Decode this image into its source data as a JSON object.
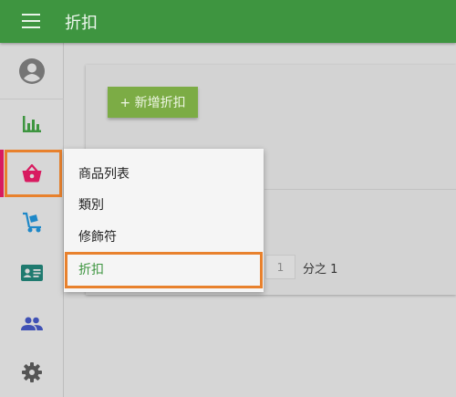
{
  "header": {
    "title": "折扣",
    "menu_icon": "hamburger-menu-icon",
    "color": "#3e9540"
  },
  "sidebar": {
    "items": [
      {
        "name": "account",
        "icon": "account-circle-icon"
      },
      {
        "name": "reports",
        "icon": "bar-chart-icon",
        "color": "#3e9540"
      },
      {
        "name": "shop",
        "icon": "shopping-basket-icon",
        "color": "#d81b60",
        "active": true
      },
      {
        "name": "delivery",
        "icon": "hand-truck-icon",
        "color": "#1e88c8"
      },
      {
        "name": "customers",
        "icon": "id-card-icon",
        "color": "#1f7a6f"
      },
      {
        "name": "users",
        "icon": "people-icon",
        "color": "#3f51b5"
      },
      {
        "name": "settings",
        "icon": "gear-icon",
        "color": "#555555"
      }
    ]
  },
  "main": {
    "add_button_label": "+ 新增折扣",
    "pager": {
      "page_value": "1",
      "total_text": "分之 1"
    }
  },
  "submenu": {
    "items": [
      {
        "label": "商品列表"
      },
      {
        "label": "類別"
      },
      {
        "label": "修飾符"
      },
      {
        "label": "折扣",
        "active": true
      }
    ]
  },
  "highlight_color": "#e8812d"
}
